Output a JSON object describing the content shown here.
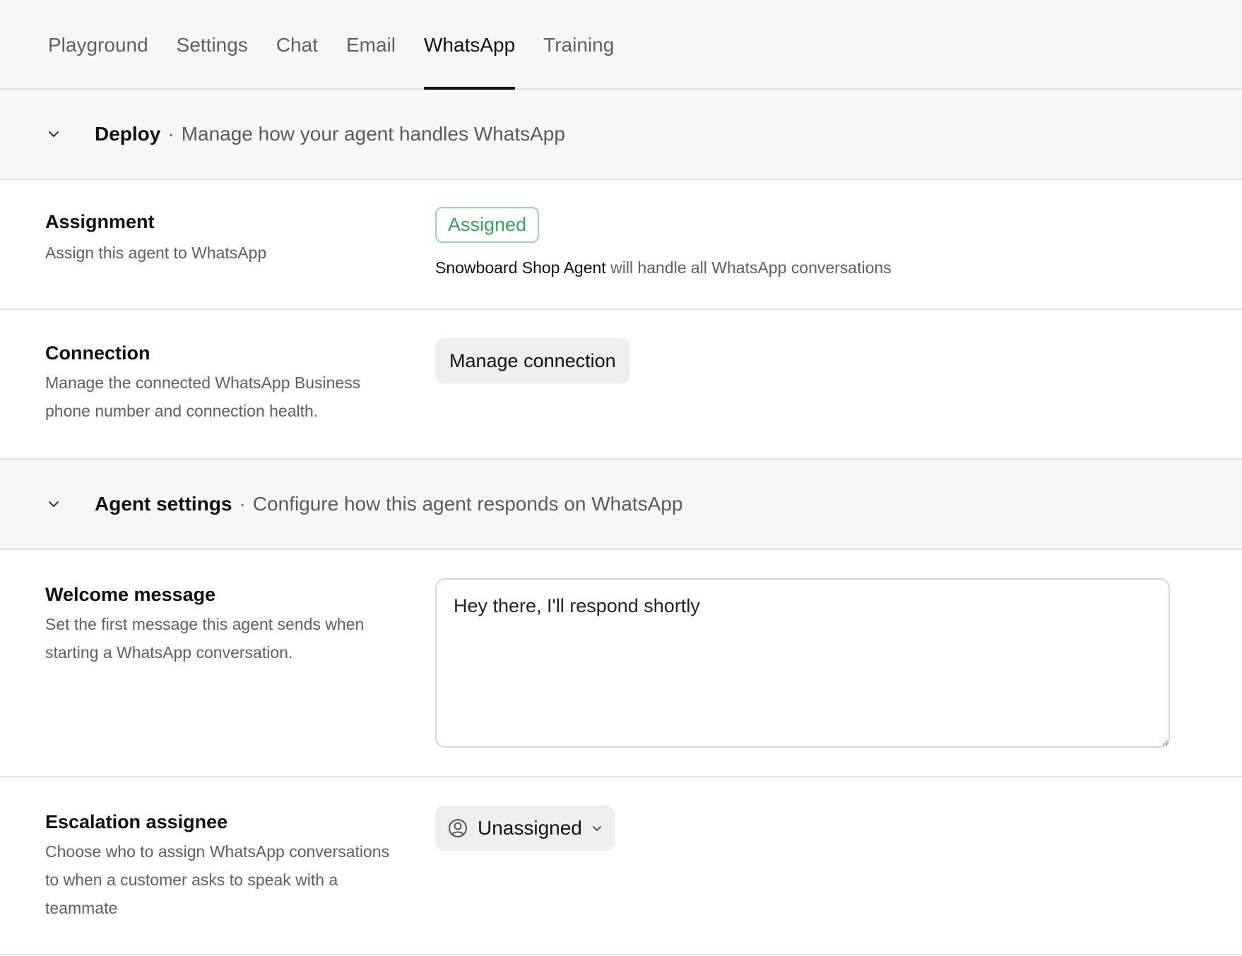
{
  "tabs": [
    {
      "label": "Playground",
      "active": false
    },
    {
      "label": "Settings",
      "active": false
    },
    {
      "label": "Chat",
      "active": false
    },
    {
      "label": "Email",
      "active": false
    },
    {
      "label": "WhatsApp",
      "active": true
    },
    {
      "label": "Training",
      "active": false
    }
  ],
  "deploy": {
    "title": "Deploy",
    "separator": "·",
    "description": "Manage how your agent handles WhatsApp",
    "assignment": {
      "title": "Assignment",
      "description": "Assign this agent to WhatsApp",
      "badge": "Assigned",
      "agent_name": "Snowboard Shop Agent",
      "handle_text": " will handle all WhatsApp conversations"
    },
    "connection": {
      "title": "Connection",
      "description": "Manage the connected WhatsApp Business phone number and connection health.",
      "button_label": "Manage connection"
    }
  },
  "agent_settings": {
    "title": "Agent settings",
    "separator": "·",
    "description": "Configure how this agent responds on WhatsApp",
    "welcome": {
      "title": "Welcome message",
      "description": "Set the first message this agent sends when starting a WhatsApp conversation.",
      "value": "Hey there, I'll respond shortly"
    },
    "escalation": {
      "title": "Escalation assignee",
      "description": "Choose who to assign WhatsApp conversations to when a customer asks to speak with a teammate",
      "selected": "Unassigned",
      "icon": "user-circle-icon"
    }
  },
  "colors": {
    "accent_green": "#35a25a",
    "badge_border": "#9fd3ae",
    "header_bg": "#f7f7f7"
  }
}
